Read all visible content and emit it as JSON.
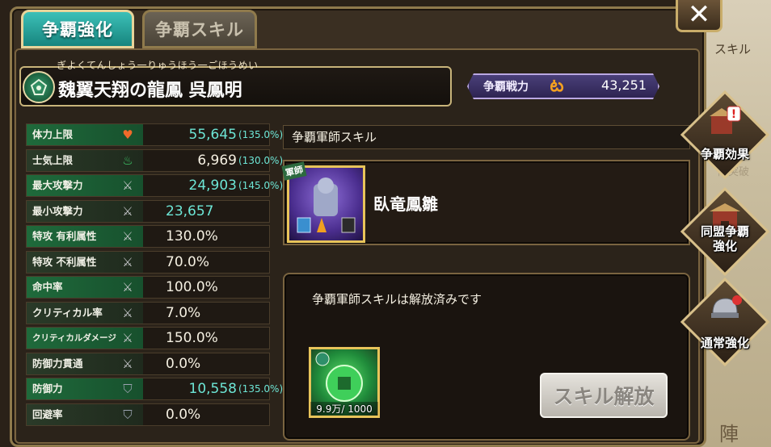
{
  "tabs": [
    {
      "label": "争覇強化",
      "active": true
    },
    {
      "label": "争覇スキル",
      "active": false
    }
  ],
  "character": {
    "ruby": "ぎよくてんしょう一りゅうほう一ごほうめい",
    "name": "魏翼天翔の龍鳳 呉鳳明"
  },
  "power": {
    "label": "争覇戦力",
    "icon": "flame-swirl-icon",
    "value": "43,251"
  },
  "stats": [
    {
      "label": "体力上限",
      "icon": "heart-icon",
      "value": "55,645",
      "pct": "(135.0%)",
      "buffed": true
    },
    {
      "label": "士気上限",
      "icon": "green-flame-icon",
      "value": "6,969",
      "pct": "(130.0%)",
      "buffed": false
    },
    {
      "label": "最大攻撃力",
      "icon": "sword-icon",
      "value": "24,903",
      "pct": "(145.0%)",
      "buffed": true
    },
    {
      "label": "最小攻撃力",
      "icon": "sword-icon",
      "value": "23,657",
      "pct": "",
      "buffed": true
    },
    {
      "label": "特攻 有利属性",
      "icon": "sword-icon",
      "value": "130.0%",
      "pct": "",
      "buffed": false
    },
    {
      "label": "特攻 不利属性",
      "icon": "sword-icon",
      "value": "70.0%",
      "pct": "",
      "buffed": false
    },
    {
      "label": "命中率",
      "icon": "sword-icon",
      "value": "100.0%",
      "pct": "",
      "buffed": false
    },
    {
      "label": "クリティカル率",
      "icon": "sword-icon",
      "value": "7.0%",
      "pct": "",
      "buffed": false
    },
    {
      "label": "クリティカルダメージ",
      "icon": "sword-icon",
      "value": "150.0%",
      "pct": "",
      "buffed": false
    },
    {
      "label": "防御力貫通",
      "icon": "sword-icon",
      "value": "0.0%",
      "pct": "",
      "buffed": false
    },
    {
      "label": "防御力",
      "icon": "shield-icon",
      "value": "10,558",
      "pct": "(135.0%)",
      "buffed": true
    },
    {
      "label": "回避率",
      "icon": "shield-icon",
      "value": "0.0%",
      "pct": "",
      "buffed": false
    }
  ],
  "skill": {
    "header": "争覇軍師スキル",
    "badge": "軍師",
    "name": "臥竜鳳雛"
  },
  "status": {
    "message": "争覇軍師スキルは解放済みです",
    "item_count": "9.9万/ 1000",
    "unlock_label": "スキル解放"
  },
  "close_label": "✕",
  "side_menu": [
    {
      "label": "争覇効果",
      "icon": "fortress-alert-icon"
    },
    {
      "label": "同盟争覇\n強化",
      "icon": "fortress-icon"
    },
    {
      "label": "通常強化",
      "icon": "helmet-scroll-icon"
    }
  ],
  "background": {
    "text_1": "スキル",
    "text_2": "限突破",
    "text_3": "陣"
  }
}
